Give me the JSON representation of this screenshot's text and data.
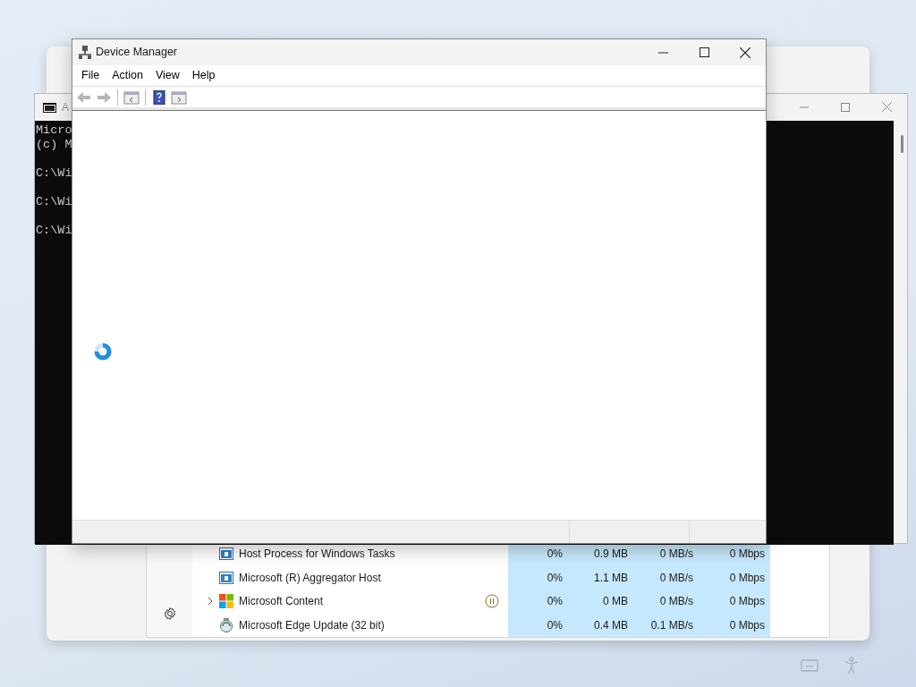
{
  "task_manager": {
    "rows": [
      {
        "name": "Host Process for Windows Tasks",
        "kind": "app",
        "expandable": false,
        "suspended": false,
        "cpu": "0%",
        "memory": "0.9 MB",
        "disk": "0 MB/s",
        "network": "0 Mbps"
      },
      {
        "name": "Microsoft (R) Aggregator Host",
        "kind": "app",
        "expandable": false,
        "suspended": false,
        "cpu": "0%",
        "memory": "1.1 MB",
        "disk": "0 MB/s",
        "network": "0 Mbps"
      },
      {
        "name": "Microsoft Content",
        "kind": "tiles",
        "expandable": true,
        "suspended": true,
        "cpu": "0%",
        "memory": "0 MB",
        "disk": "0 MB/s",
        "network": "0 Mbps"
      },
      {
        "name": "Microsoft Edge Update (32 bit)",
        "kind": "updater",
        "expandable": false,
        "suspended": false,
        "cpu": "0%",
        "memory": "0.4 MB",
        "disk": "0.1 MB/s",
        "network": "0 Mbps"
      }
    ]
  },
  "console": {
    "title": "A",
    "blocks": [
      [
        "Micro",
        "(c) M"
      ],
      [
        "C:\\Wi"
      ],
      [
        "C:\\Wi"
      ],
      [
        "C:\\Wi"
      ]
    ]
  },
  "device_manager": {
    "title": "Device Manager",
    "menu": [
      "File",
      "Action",
      "View",
      "Help"
    ],
    "toolbar": [
      {
        "kind": "back",
        "disabled": true
      },
      {
        "kind": "forward",
        "disabled": true
      },
      {
        "kind": "sep"
      },
      {
        "kind": "tree",
        "disabled": false
      },
      {
        "kind": "sep"
      },
      {
        "kind": "help",
        "disabled": false
      },
      {
        "kind": "panel",
        "disabled": false
      }
    ],
    "loading": true
  }
}
